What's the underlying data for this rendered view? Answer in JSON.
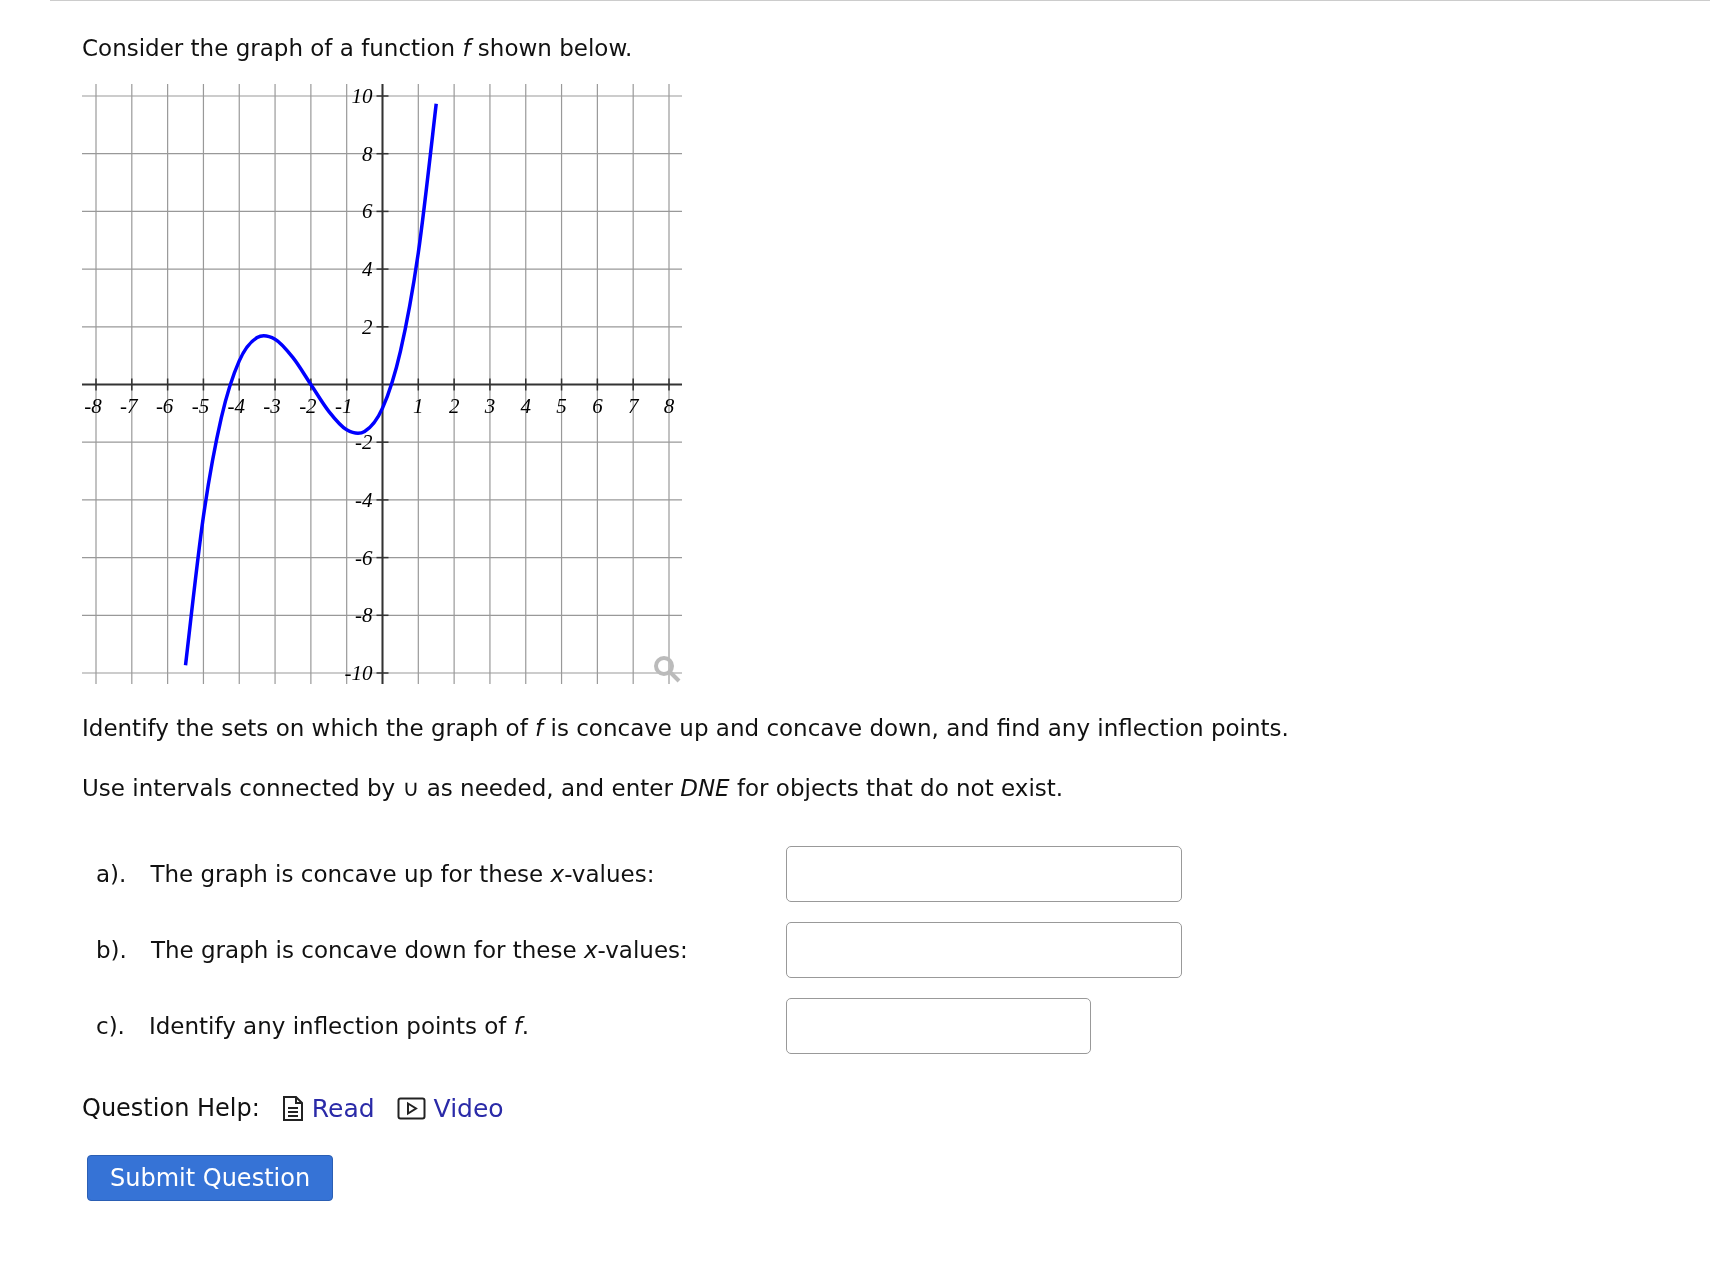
{
  "prompt": "Consider the graph of a function *f* shown below.",
  "graph": {
    "chart_data": {
      "type": "line",
      "grid": true,
      "xlim": [
        -8,
        8
      ],
      "ylim": [
        -10,
        10
      ],
      "xticks": [
        -8,
        -7,
        -6,
        -5,
        -4,
        -3,
        -2,
        -1,
        1,
        2,
        3,
        4,
        5,
        6,
        7,
        8
      ],
      "yticks": [
        -10,
        -8,
        -6,
        -4,
        -2,
        2,
        4,
        6,
        8,
        10
      ],
      "x": [
        -5.5,
        -5,
        -4.5,
        -4,
        -3.5,
        -3,
        -2.5,
        -2,
        -1.5,
        -1,
        -0.5,
        0,
        0.5,
        1,
        1.5
      ],
      "series": [
        {
          "color": "#0000ff",
          "values": [
            -9.73,
            -4.57,
            -1.15,
            0.82,
            1.63,
            1.57,
            0.93,
            0,
            -0.93,
            -1.57,
            -1.63,
            -0.82,
            1.15,
            4.57,
            9.73
          ]
        }
      ]
    }
  },
  "instructions": [
    "Identify the sets on which the graph of *f* is concave up and concave down, and find any inflection points.",
    "Use intervals connected by ∪ as needed, and enter *DNE* for objects that do not exist."
  ],
  "parts": [
    {
      "label": "a).",
      "text": "The graph is concave up for these *x*-values:",
      "kind": "interval"
    },
    {
      "label": "b).",
      "text": "The graph is concave down for these *x*-values:",
      "kind": "interval"
    },
    {
      "label": "c).",
      "text": "Identify any inflection points of *f*.",
      "kind": "point"
    }
  ],
  "help": {
    "label": "Question Help:",
    "links": [
      {
        "kind": "read",
        "text": "Read"
      },
      {
        "kind": "video",
        "text": "Video"
      }
    ]
  },
  "submit": "Submit Question"
}
